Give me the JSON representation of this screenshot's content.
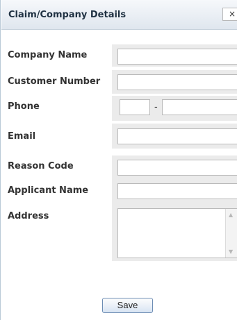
{
  "dialog": {
    "title": "Claim/Company Details",
    "close_label": "×"
  },
  "fields": {
    "company_name": {
      "label": "Company Name",
      "value": ""
    },
    "customer_number": {
      "label": "Customer Number",
      "value": ""
    },
    "phone": {
      "label": "Phone",
      "separator": "-",
      "area_value": "",
      "number_value": ""
    },
    "email": {
      "label": "Email",
      "value": ""
    },
    "reason_code": {
      "label": "Reason Code",
      "value": ""
    },
    "applicant_name": {
      "label": "Applicant Name",
      "value": ""
    },
    "address": {
      "label": "Address",
      "value": ""
    }
  },
  "actions": {
    "save_label": "Save"
  },
  "icons": {
    "close": "close-icon",
    "scroll_up": "scroll-up-arrow-icon",
    "scroll_down": "scroll-down-arrow-icon"
  }
}
